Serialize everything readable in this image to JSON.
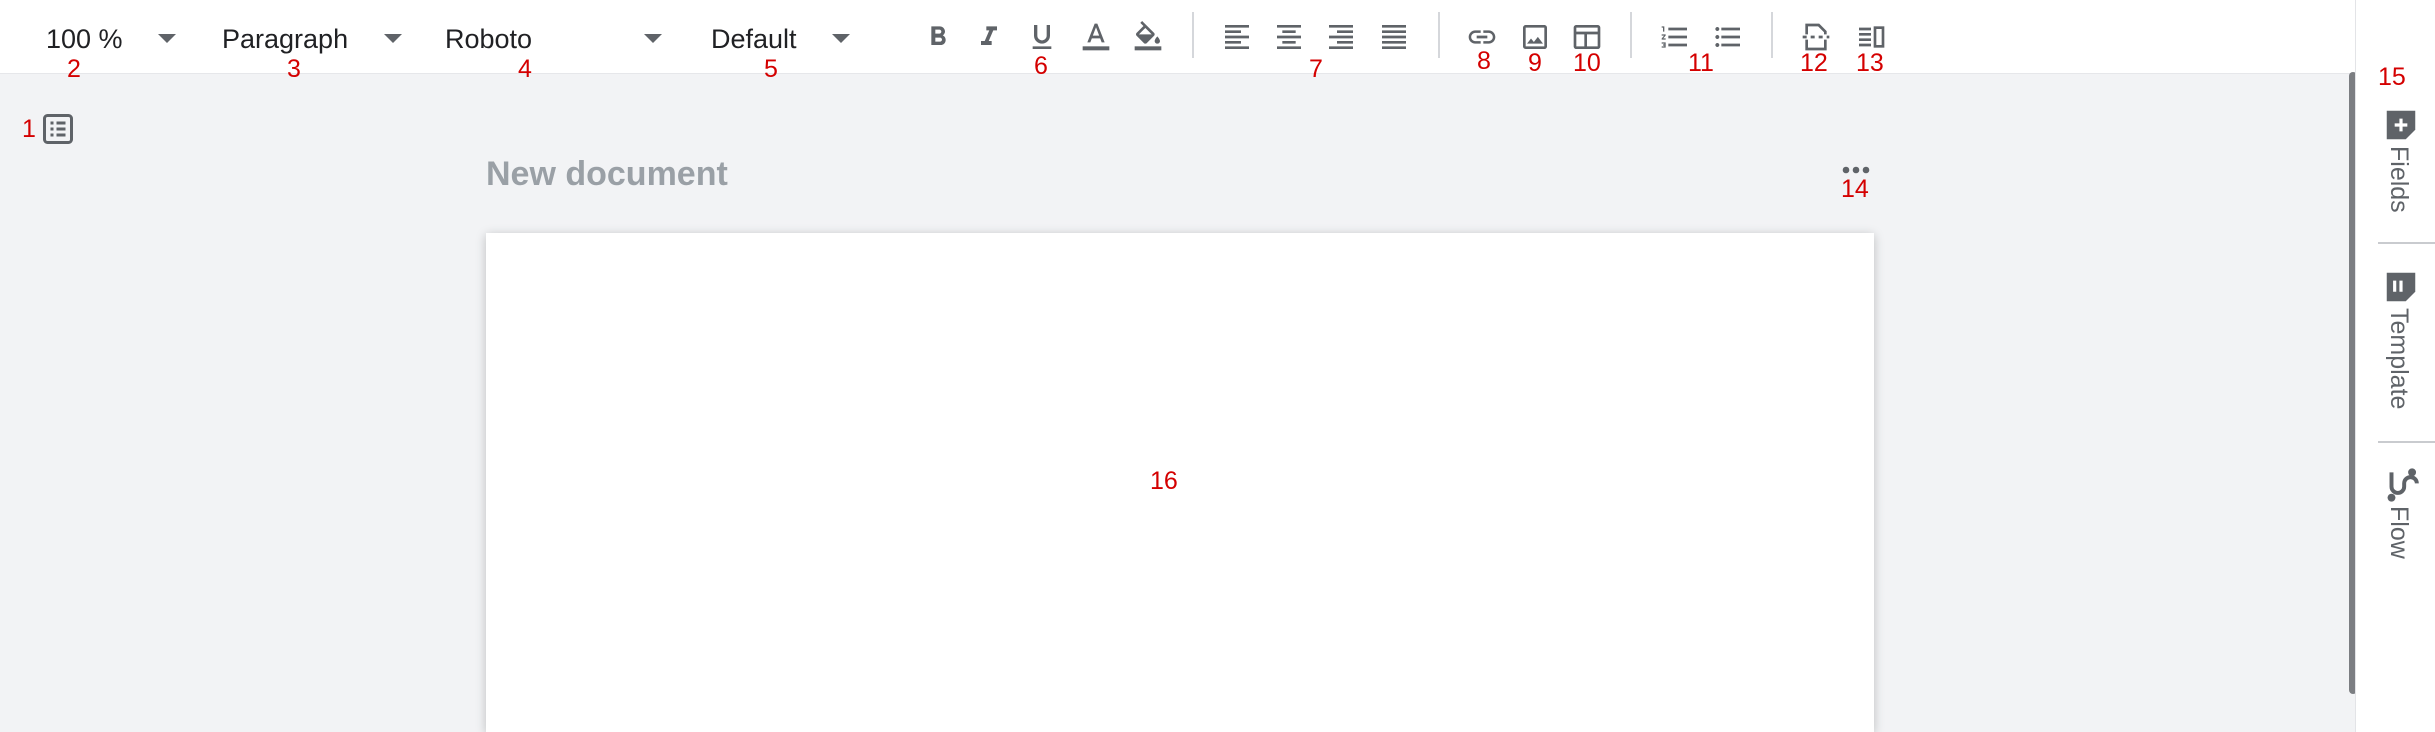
{
  "toolbar": {
    "zoom": {
      "value": "100 %"
    },
    "block_style": {
      "value": "Paragraph"
    },
    "font_family": {
      "value": "Roboto"
    },
    "font_size": {
      "value": "Default"
    },
    "buttons": [
      "bold-icon",
      "italic-icon",
      "underline-icon",
      "text-color-icon",
      "highlight-icon",
      "align-left-icon",
      "align-center-icon",
      "align-right-icon",
      "align-justify-icon",
      "link-icon",
      "image-icon",
      "table-icon",
      "numbered-list-icon",
      "bulleted-list-icon",
      "page-break-icon",
      "columns-icon"
    ]
  },
  "document": {
    "title": "New document"
  },
  "sidebar": {
    "tabs": [
      {
        "label": "Fields",
        "icon": "add-field-icon"
      },
      {
        "label": "Template",
        "icon": "template-icon"
      },
      {
        "label": "Flow",
        "icon": "flow-icon"
      }
    ]
  },
  "annotations": [
    "1",
    "2",
    "3",
    "4",
    "5",
    "6",
    "7",
    "8",
    "9",
    "10",
    "11",
    "12",
    "13",
    "14",
    "15",
    "16"
  ],
  "colors": {
    "annotation": "#d40000",
    "icon": "#5f6368",
    "background": "#f2f3f5",
    "title": "#9aa0a6"
  }
}
